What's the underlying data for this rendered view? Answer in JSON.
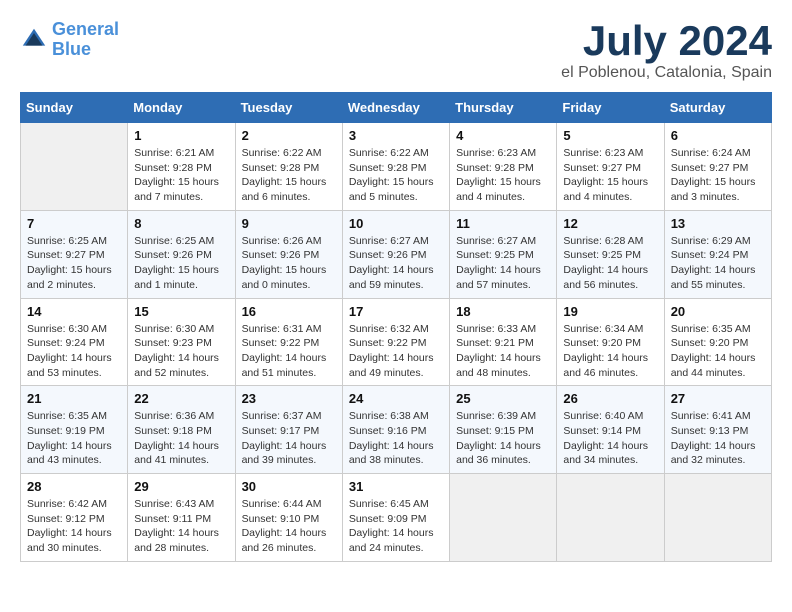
{
  "header": {
    "logo_line1": "General",
    "logo_line2": "Blue",
    "month_title": "July 2024",
    "location": "el Poblenou, Catalonia, Spain"
  },
  "weekdays": [
    "Sunday",
    "Monday",
    "Tuesday",
    "Wednesday",
    "Thursday",
    "Friday",
    "Saturday"
  ],
  "weeks": [
    [
      {
        "day": "",
        "empty": true
      },
      {
        "day": "1",
        "sunrise": "6:21 AM",
        "sunset": "9:28 PM",
        "daylight": "15 hours and 7 minutes."
      },
      {
        "day": "2",
        "sunrise": "6:22 AM",
        "sunset": "9:28 PM",
        "daylight": "15 hours and 6 minutes."
      },
      {
        "day": "3",
        "sunrise": "6:22 AM",
        "sunset": "9:28 PM",
        "daylight": "15 hours and 5 minutes."
      },
      {
        "day": "4",
        "sunrise": "6:23 AM",
        "sunset": "9:28 PM",
        "daylight": "15 hours and 4 minutes."
      },
      {
        "day": "5",
        "sunrise": "6:23 AM",
        "sunset": "9:27 PM",
        "daylight": "15 hours and 4 minutes."
      },
      {
        "day": "6",
        "sunrise": "6:24 AM",
        "sunset": "9:27 PM",
        "daylight": "15 hours and 3 minutes."
      }
    ],
    [
      {
        "day": "7",
        "sunrise": "6:25 AM",
        "sunset": "9:27 PM",
        "daylight": "15 hours and 2 minutes."
      },
      {
        "day": "8",
        "sunrise": "6:25 AM",
        "sunset": "9:26 PM",
        "daylight": "15 hours and 1 minute."
      },
      {
        "day": "9",
        "sunrise": "6:26 AM",
        "sunset": "9:26 PM",
        "daylight": "15 hours and 0 minutes."
      },
      {
        "day": "10",
        "sunrise": "6:27 AM",
        "sunset": "9:26 PM",
        "daylight": "14 hours and 59 minutes."
      },
      {
        "day": "11",
        "sunrise": "6:27 AM",
        "sunset": "9:25 PM",
        "daylight": "14 hours and 57 minutes."
      },
      {
        "day": "12",
        "sunrise": "6:28 AM",
        "sunset": "9:25 PM",
        "daylight": "14 hours and 56 minutes."
      },
      {
        "day": "13",
        "sunrise": "6:29 AM",
        "sunset": "9:24 PM",
        "daylight": "14 hours and 55 minutes."
      }
    ],
    [
      {
        "day": "14",
        "sunrise": "6:30 AM",
        "sunset": "9:24 PM",
        "daylight": "14 hours and 53 minutes."
      },
      {
        "day": "15",
        "sunrise": "6:30 AM",
        "sunset": "9:23 PM",
        "daylight": "14 hours and 52 minutes."
      },
      {
        "day": "16",
        "sunrise": "6:31 AM",
        "sunset": "9:22 PM",
        "daylight": "14 hours and 51 minutes."
      },
      {
        "day": "17",
        "sunrise": "6:32 AM",
        "sunset": "9:22 PM",
        "daylight": "14 hours and 49 minutes."
      },
      {
        "day": "18",
        "sunrise": "6:33 AM",
        "sunset": "9:21 PM",
        "daylight": "14 hours and 48 minutes."
      },
      {
        "day": "19",
        "sunrise": "6:34 AM",
        "sunset": "9:20 PM",
        "daylight": "14 hours and 46 minutes."
      },
      {
        "day": "20",
        "sunrise": "6:35 AM",
        "sunset": "9:20 PM",
        "daylight": "14 hours and 44 minutes."
      }
    ],
    [
      {
        "day": "21",
        "sunrise": "6:35 AM",
        "sunset": "9:19 PM",
        "daylight": "14 hours and 43 minutes."
      },
      {
        "day": "22",
        "sunrise": "6:36 AM",
        "sunset": "9:18 PM",
        "daylight": "14 hours and 41 minutes."
      },
      {
        "day": "23",
        "sunrise": "6:37 AM",
        "sunset": "9:17 PM",
        "daylight": "14 hours and 39 minutes."
      },
      {
        "day": "24",
        "sunrise": "6:38 AM",
        "sunset": "9:16 PM",
        "daylight": "14 hours and 38 minutes."
      },
      {
        "day": "25",
        "sunrise": "6:39 AM",
        "sunset": "9:15 PM",
        "daylight": "14 hours and 36 minutes."
      },
      {
        "day": "26",
        "sunrise": "6:40 AM",
        "sunset": "9:14 PM",
        "daylight": "14 hours and 34 minutes."
      },
      {
        "day": "27",
        "sunrise": "6:41 AM",
        "sunset": "9:13 PM",
        "daylight": "14 hours and 32 minutes."
      }
    ],
    [
      {
        "day": "28",
        "sunrise": "6:42 AM",
        "sunset": "9:12 PM",
        "daylight": "14 hours and 30 minutes."
      },
      {
        "day": "29",
        "sunrise": "6:43 AM",
        "sunset": "9:11 PM",
        "daylight": "14 hours and 28 minutes."
      },
      {
        "day": "30",
        "sunrise": "6:44 AM",
        "sunset": "9:10 PM",
        "daylight": "14 hours and 26 minutes."
      },
      {
        "day": "31",
        "sunrise": "6:45 AM",
        "sunset": "9:09 PM",
        "daylight": "14 hours and 24 minutes."
      },
      {
        "day": "",
        "empty": true
      },
      {
        "day": "",
        "empty": true
      },
      {
        "day": "",
        "empty": true
      }
    ]
  ]
}
